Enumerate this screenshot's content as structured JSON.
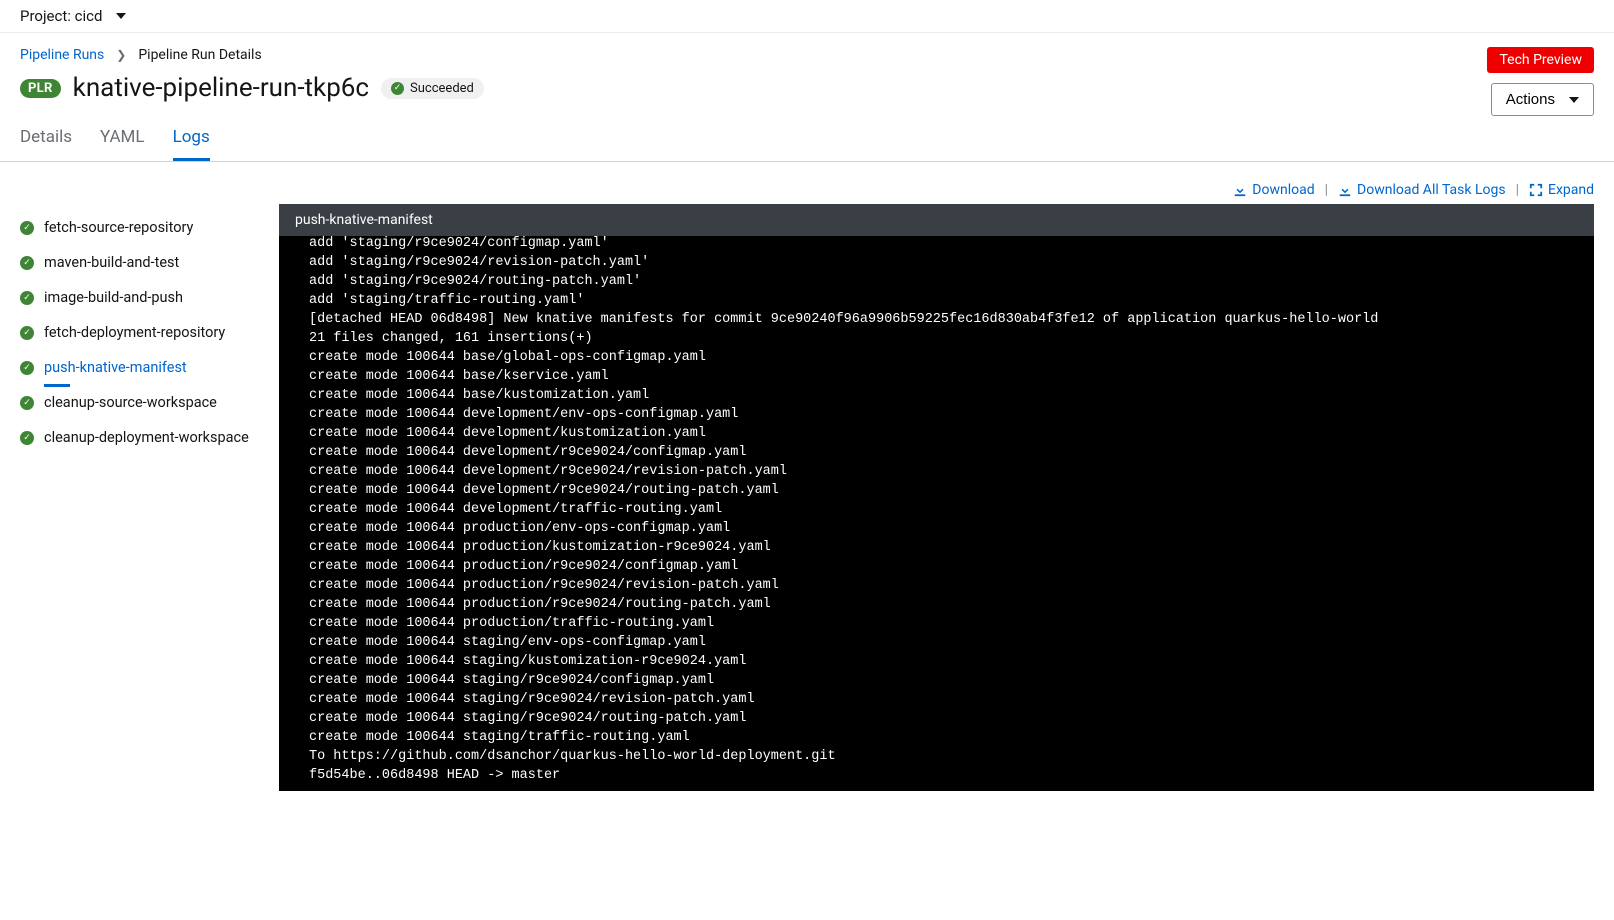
{
  "topbar": {
    "project_label": "Project: cicd"
  },
  "breadcrumbs": {
    "parent": "Pipeline Runs",
    "current": "Pipeline Run Details"
  },
  "header": {
    "resource_badge": "PLR",
    "title": "knative-pipeline-run-tkp6c",
    "status": "Succeeded",
    "tech_preview": "Tech Preview",
    "actions_label": "Actions"
  },
  "tabs": {
    "details": "Details",
    "yaml": "YAML",
    "logs": "Logs"
  },
  "tasks": [
    {
      "name": "fetch-source-repository",
      "active": false
    },
    {
      "name": "maven-build-and-test",
      "active": false
    },
    {
      "name": "image-build-and-push",
      "active": false
    },
    {
      "name": "fetch-deployment-repository",
      "active": false
    },
    {
      "name": "push-knative-manifest",
      "active": true
    },
    {
      "name": "cleanup-source-workspace",
      "active": false
    },
    {
      "name": "cleanup-deployment-workspace",
      "active": false
    }
  ],
  "log_actions": {
    "download": "Download",
    "download_all": "Download All Task Logs",
    "expand": "Expand"
  },
  "log": {
    "header": "push-knative-manifest",
    "lines": [
      "add 'staging/r9ce9024/configmap.yaml'",
      "add 'staging/r9ce9024/revision-patch.yaml'",
      "add 'staging/r9ce9024/routing-patch.yaml'",
      "add 'staging/traffic-routing.yaml'",
      "[detached HEAD 06d8498] New knative manifests for commit 9ce90240f96a9906b59225fec16d830ab4f3fe12 of application quarkus-hello-world",
      "21 files changed, 161 insertions(+)",
      "create mode 100644 base/global-ops-configmap.yaml",
      "create mode 100644 base/kservice.yaml",
      "create mode 100644 base/kustomization.yaml",
      "create mode 100644 development/env-ops-configmap.yaml",
      "create mode 100644 development/kustomization.yaml",
      "create mode 100644 development/r9ce9024/configmap.yaml",
      "create mode 100644 development/r9ce9024/revision-patch.yaml",
      "create mode 100644 development/r9ce9024/routing-patch.yaml",
      "create mode 100644 development/traffic-routing.yaml",
      "create mode 100644 production/env-ops-configmap.yaml",
      "create mode 100644 production/kustomization-r9ce9024.yaml",
      "create mode 100644 production/r9ce9024/configmap.yaml",
      "create mode 100644 production/r9ce9024/revision-patch.yaml",
      "create mode 100644 production/r9ce9024/routing-patch.yaml",
      "create mode 100644 production/traffic-routing.yaml",
      "create mode 100644 staging/env-ops-configmap.yaml",
      "create mode 100644 staging/kustomization-r9ce9024.yaml",
      "create mode 100644 staging/r9ce9024/configmap.yaml",
      "create mode 100644 staging/r9ce9024/revision-patch.yaml",
      "create mode 100644 staging/r9ce9024/routing-patch.yaml",
      "create mode 100644 staging/traffic-routing.yaml",
      "To https://github.com/dsanchor/quarkus-hello-world-deployment.git",
      "f5d54be..06d8498 HEAD -> master"
    ]
  }
}
